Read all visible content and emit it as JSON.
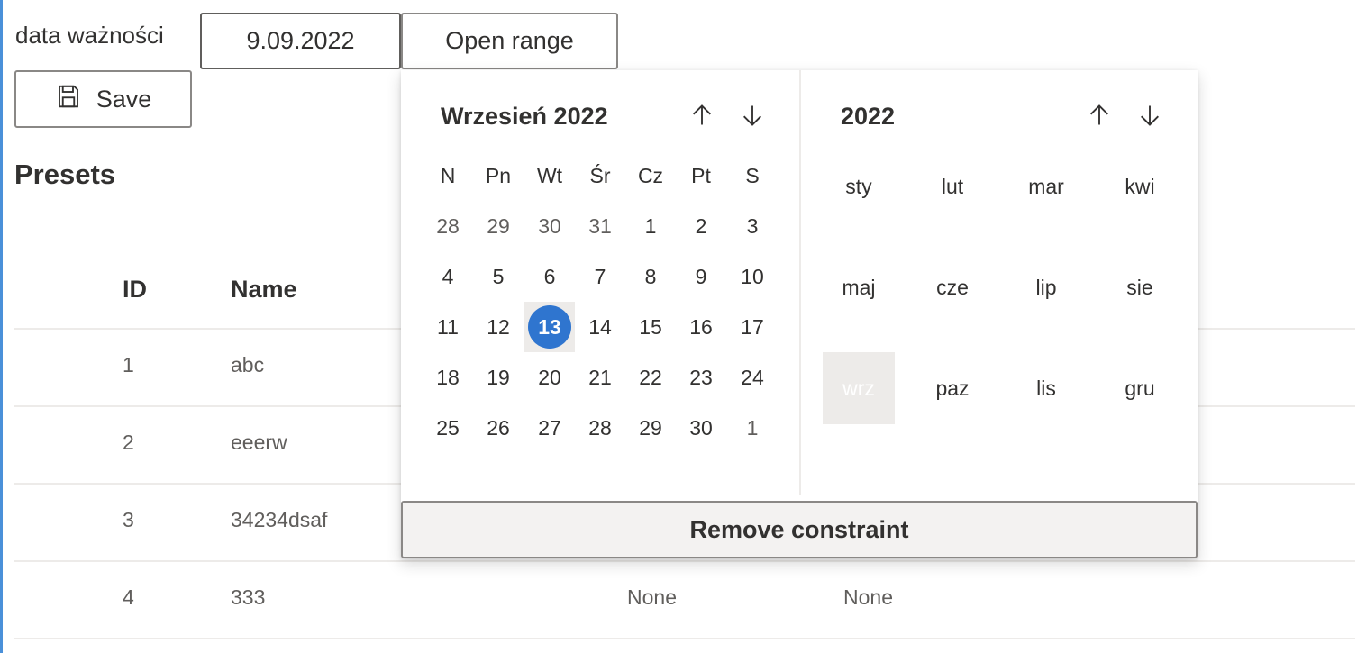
{
  "form": {
    "date_label": "data ważności",
    "date_value": "9.09.2022",
    "open_range_label": "Open range",
    "save_label": "Save"
  },
  "presets": {
    "title": "Presets",
    "columns": [
      "ID",
      "Name"
    ],
    "rows": [
      {
        "id": "1",
        "name": "abc",
        "c3": "",
        "c4": ""
      },
      {
        "id": "2",
        "name": "eeerw",
        "c3": "",
        "c4": ""
      },
      {
        "id": "3",
        "name": "34234dsaf",
        "c3": "",
        "c4": ""
      },
      {
        "id": "4",
        "name": "333",
        "c3": "None",
        "c4": "None"
      }
    ]
  },
  "calendar": {
    "month_title": "Wrzesień 2022",
    "year_title": "2022",
    "weekdays": [
      "N",
      "Pn",
      "Wt",
      "Śr",
      "Cz",
      "Pt",
      "S"
    ],
    "weeks": [
      [
        "28",
        "29",
        "30",
        "31",
        "1",
        "2",
        "3"
      ],
      [
        "4",
        "5",
        "6",
        "7",
        "8",
        "9",
        "10"
      ],
      [
        "11",
        "12",
        "13",
        "14",
        "15",
        "16",
        "17"
      ],
      [
        "18",
        "19",
        "20",
        "21",
        "22",
        "23",
        "24"
      ],
      [
        "25",
        "26",
        "27",
        "28",
        "29",
        "30",
        "1"
      ]
    ],
    "selected_day": "13",
    "months": [
      "sty",
      "lut",
      "mar",
      "kwi",
      "maj",
      "cze",
      "lip",
      "sie",
      "wrz",
      "paz",
      "lis",
      "gru"
    ],
    "current_month": "wrz",
    "remove_label": "Remove constraint",
    "accent_color": "#2f75cf"
  },
  "icons": {
    "save": "save-icon",
    "up": "arrow-up-icon",
    "down": "arrow-down-icon"
  }
}
